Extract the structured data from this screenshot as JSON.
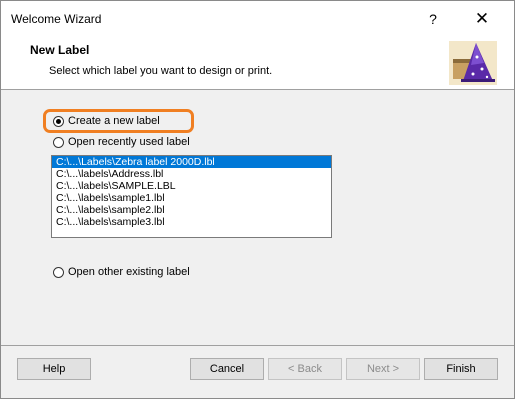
{
  "window": {
    "title": "Welcome Wizard",
    "help_glyph": "?",
    "close_glyph": "✕"
  },
  "header": {
    "title": "New Label",
    "subtitle": "Select which label you want to design or print."
  },
  "options": {
    "create_new": "Create a new label",
    "open_recent": "Open recently used label",
    "open_other": "Open other existing label"
  },
  "recent_files": [
    "C:\\...\\Labels\\Zebra label 2000D.lbl",
    "C:\\...\\labels\\Address.lbl",
    "C:\\...\\labels\\SAMPLE.LBL",
    "C:\\...\\labels\\sample1.lbl",
    "C:\\...\\labels\\sample2.lbl",
    "C:\\...\\labels\\sample3.lbl"
  ],
  "buttons": {
    "help": "Help",
    "cancel": "Cancel",
    "back": "< Back",
    "next": "Next >",
    "finish": "Finish"
  },
  "colors": {
    "highlight": "#f07f22",
    "selection": "#0078d7"
  }
}
